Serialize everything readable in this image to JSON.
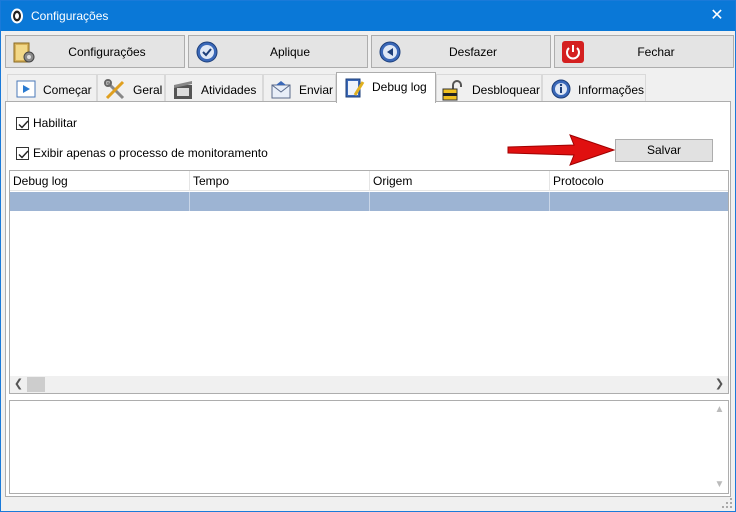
{
  "window": {
    "title": "Configurações"
  },
  "toolbar": [
    {
      "label": "Configurações",
      "icon": "settings-folder-icon"
    },
    {
      "label": "Aplique",
      "icon": "apply-check-icon"
    },
    {
      "label": "Desfazer",
      "icon": "undo-icon"
    },
    {
      "label": "Fechar",
      "icon": "power-icon"
    }
  ],
  "tabs": [
    {
      "label": "Começar",
      "icon": "play-icon"
    },
    {
      "label": "Geral",
      "icon": "tools-icon"
    },
    {
      "label": "Atividades",
      "icon": "film-icon"
    },
    {
      "label": "Enviar",
      "icon": "envelope-icon"
    },
    {
      "label": "Debug log",
      "icon": "notebook-pencil-icon",
      "active": true
    },
    {
      "label": "Desbloquear",
      "icon": "padlock-icon"
    },
    {
      "label": "Informações",
      "icon": "info-icon"
    }
  ],
  "debug": {
    "enable_label": "Habilitar",
    "enable_checked": true,
    "monitor_only_label": "Exibir apenas o processo de monitoramento",
    "monitor_only_checked": true,
    "save_label": "Salvar"
  },
  "grid": {
    "columns": [
      "Debug log",
      "Tempo",
      "Origem",
      "Protocolo"
    ]
  },
  "colors": {
    "titlebar": "#0a78d7",
    "selected_row": "#9db4d3",
    "arrow": "#e01010"
  }
}
